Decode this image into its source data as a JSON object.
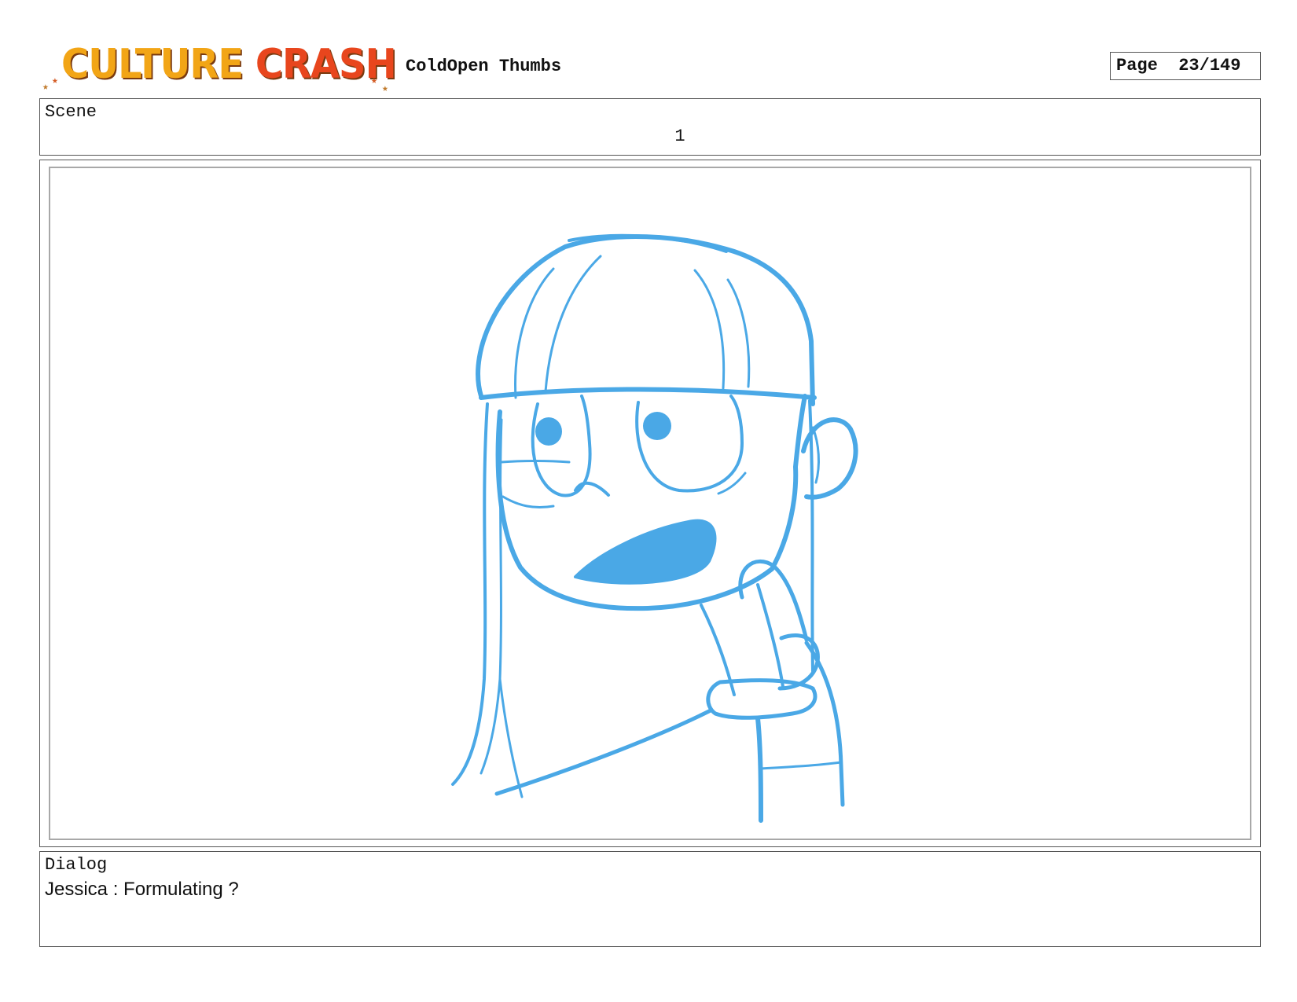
{
  "header": {
    "logo": {
      "word1": "CULTURE",
      "word2": "CRASH"
    },
    "title": "ColdOpen Thumbs",
    "page_label": "Page",
    "page_number": "23/149"
  },
  "scene": {
    "label": "Scene",
    "number": "1"
  },
  "panel": {
    "sketch_color": "#4aa8e6"
  },
  "dialog": {
    "label": "Dialog",
    "text": "Jessica : Formulating ?"
  }
}
